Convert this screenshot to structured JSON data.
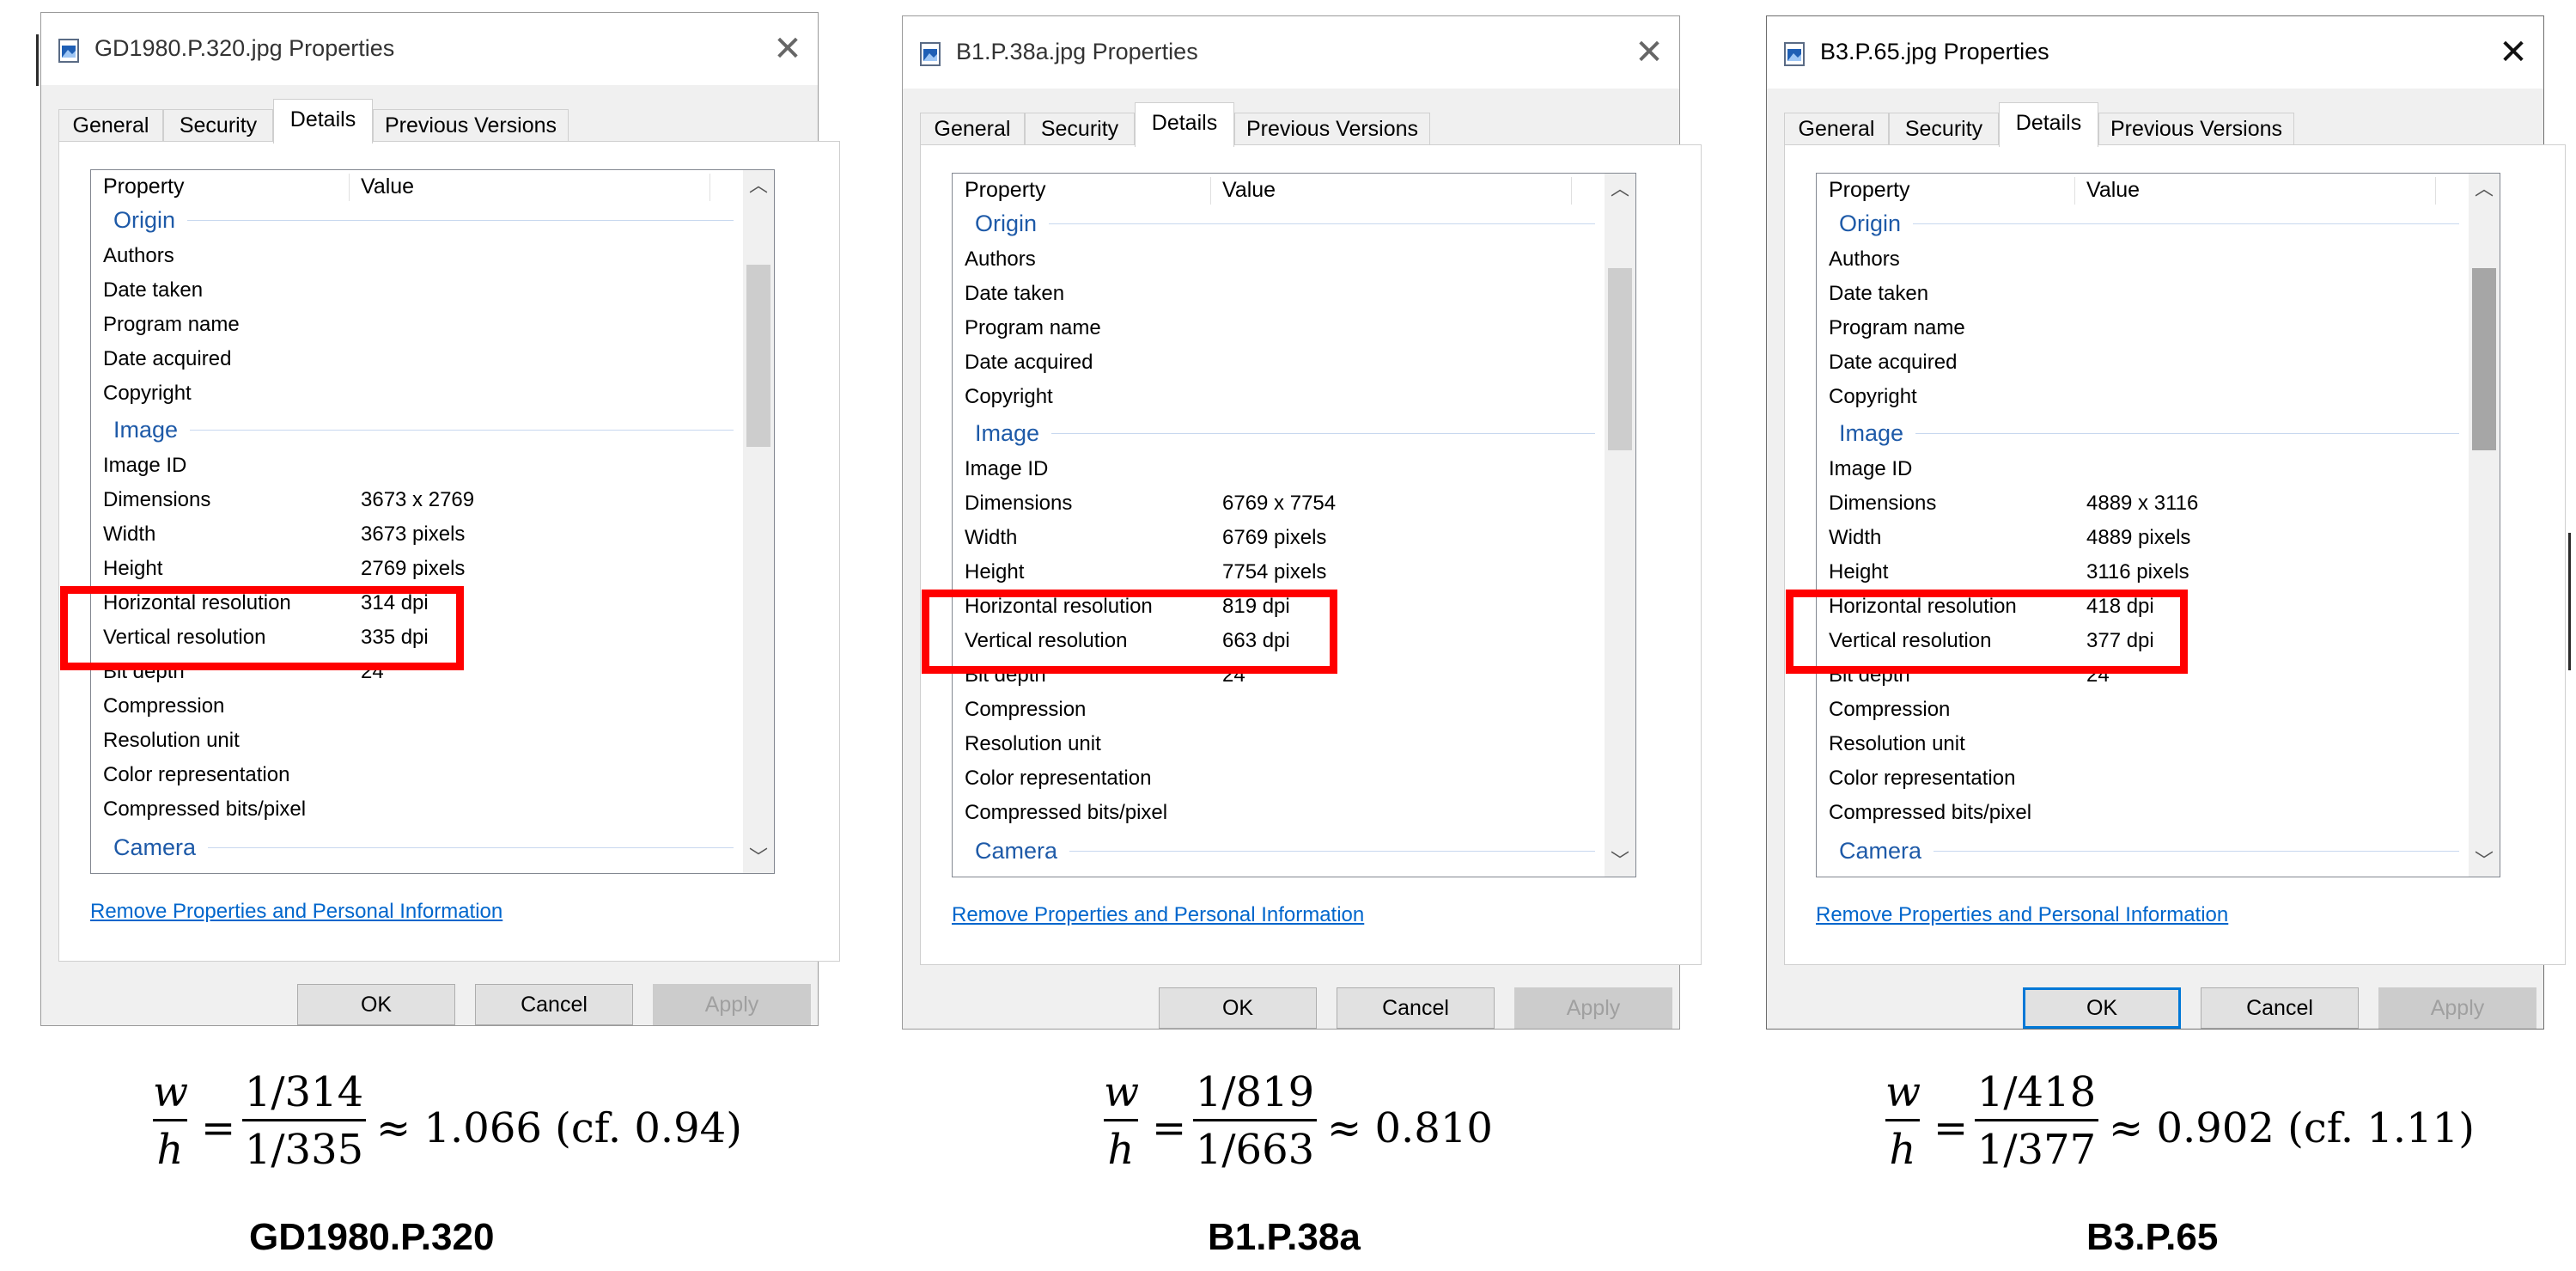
{
  "panels": [
    {
      "window_title": "GD1980.P.320.jpg Properties",
      "tabs": [
        "General",
        "Security",
        "Details",
        "Previous Versions"
      ],
      "selected_tab": "Details",
      "columns": {
        "property": "Property",
        "value": "Value"
      },
      "groups": {
        "origin": "Origin",
        "image": "Image",
        "camera": "Camera"
      },
      "origin_rows": [
        {
          "name": "Authors",
          "value": ""
        },
        {
          "name": "Date taken",
          "value": ""
        },
        {
          "name": "Program name",
          "value": ""
        },
        {
          "name": "Date acquired",
          "value": ""
        },
        {
          "name": "Copyright",
          "value": ""
        }
      ],
      "image_rows": [
        {
          "name": "Image ID",
          "value": ""
        },
        {
          "name": "Dimensions",
          "value": "3673 x 2769"
        },
        {
          "name": "Width",
          "value": "3673 pixels"
        },
        {
          "name": "Height",
          "value": "2769 pixels"
        },
        {
          "name": "Horizontal resolution",
          "value": "314 dpi"
        },
        {
          "name": "Vertical resolution",
          "value": "335 dpi"
        },
        {
          "name": "Bit depth",
          "value": "24"
        },
        {
          "name": "Compression",
          "value": ""
        },
        {
          "name": "Resolution unit",
          "value": ""
        },
        {
          "name": "Color representation",
          "value": ""
        },
        {
          "name": "Compressed bits/pixel",
          "value": ""
        }
      ],
      "link": "Remove Properties and Personal Information",
      "buttons": {
        "ok": "OK",
        "cancel": "Cancel",
        "apply": "Apply"
      },
      "formula": {
        "lhs_num": "w",
        "lhs_den": "h",
        "rhs_num": "1/314",
        "rhs_den": "1/335",
        "result": "≈ 1.066 (cf. 0.94)"
      },
      "caption": "GD1980.P.320"
    },
    {
      "window_title": "B1.P.38a.jpg Properties",
      "tabs": [
        "General",
        "Security",
        "Details",
        "Previous Versions"
      ],
      "selected_tab": "Details",
      "columns": {
        "property": "Property",
        "value": "Value"
      },
      "groups": {
        "origin": "Origin",
        "image": "Image",
        "camera": "Camera"
      },
      "origin_rows": [
        {
          "name": "Authors",
          "value": ""
        },
        {
          "name": "Date taken",
          "value": ""
        },
        {
          "name": "Program name",
          "value": ""
        },
        {
          "name": "Date acquired",
          "value": ""
        },
        {
          "name": "Copyright",
          "value": ""
        }
      ],
      "image_rows": [
        {
          "name": "Image ID",
          "value": ""
        },
        {
          "name": "Dimensions",
          "value": "6769 x 7754"
        },
        {
          "name": "Width",
          "value": "6769 pixels"
        },
        {
          "name": "Height",
          "value": "7754 pixels"
        },
        {
          "name": "Horizontal resolution",
          "value": "819 dpi"
        },
        {
          "name": "Vertical resolution",
          "value": "663 dpi"
        },
        {
          "name": "Bit depth",
          "value": "24"
        },
        {
          "name": "Compression",
          "value": ""
        },
        {
          "name": "Resolution unit",
          "value": ""
        },
        {
          "name": "Color representation",
          "value": ""
        },
        {
          "name": "Compressed bits/pixel",
          "value": ""
        }
      ],
      "link": "Remove Properties and Personal Information",
      "buttons": {
        "ok": "OK",
        "cancel": "Cancel",
        "apply": "Apply"
      },
      "formula": {
        "lhs_num": "w",
        "lhs_den": "h",
        "rhs_num": "1/819",
        "rhs_den": "1/663",
        "result": "≈ 0.810"
      },
      "caption": "B1.P.38a"
    },
    {
      "window_title": "B3.P.65.jpg Properties",
      "tabs": [
        "General",
        "Security",
        "Details",
        "Previous Versions"
      ],
      "selected_tab": "Details",
      "columns": {
        "property": "Property",
        "value": "Value"
      },
      "groups": {
        "origin": "Origin",
        "image": "Image",
        "camera": "Camera"
      },
      "origin_rows": [
        {
          "name": "Authors",
          "value": ""
        },
        {
          "name": "Date taken",
          "value": ""
        },
        {
          "name": "Program name",
          "value": ""
        },
        {
          "name": "Date acquired",
          "value": ""
        },
        {
          "name": "Copyright",
          "value": ""
        }
      ],
      "image_rows": [
        {
          "name": "Image ID",
          "value": ""
        },
        {
          "name": "Dimensions",
          "value": "4889 x 3116"
        },
        {
          "name": "Width",
          "value": "4889 pixels"
        },
        {
          "name": "Height",
          "value": "3116 pixels"
        },
        {
          "name": "Horizontal resolution",
          "value": "418 dpi"
        },
        {
          "name": "Vertical resolution",
          "value": "377 dpi"
        },
        {
          "name": "Bit depth",
          "value": "24"
        },
        {
          "name": "Compression",
          "value": ""
        },
        {
          "name": "Resolution unit",
          "value": ""
        },
        {
          "name": "Color representation",
          "value": ""
        },
        {
          "name": "Compressed bits/pixel",
          "value": ""
        }
      ],
      "link": "Remove Properties and Personal Information",
      "buttons": {
        "ok": "OK",
        "cancel": "Cancel",
        "apply": "Apply"
      },
      "formula": {
        "lhs_num": "w",
        "lhs_den": "h",
        "rhs_num": "1/418",
        "rhs_den": "1/377",
        "result": "≈ 0.902 (cf. 1.11)"
      },
      "caption": "B3.P.65"
    }
  ],
  "highlight_color": "#ff0000",
  "link_color": "#0066cc",
  "group_color": "#1e5aa8",
  "icons": {
    "title": "image-file-icon",
    "close": "close-icon",
    "scroll_up": "chevron-up-icon",
    "scroll_down": "chevron-down-icon"
  }
}
